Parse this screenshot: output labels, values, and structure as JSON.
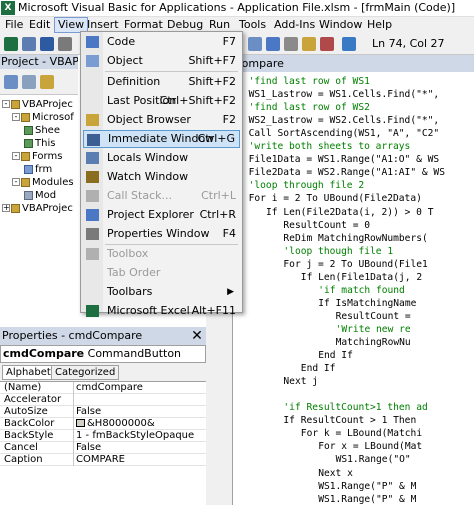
{
  "window": {
    "title": "Microsoft Visual Basic for Applications - Application File.xlsm - [frmMain (Code)]",
    "icon_text": "X"
  },
  "menubar": [
    "File",
    "Edit",
    "View",
    "Insert",
    "Format",
    "Debug",
    "Run",
    "Tools",
    "Add-Ins",
    "Window",
    "Help"
  ],
  "toolbar": {
    "position": "Ln 74, Col 27"
  },
  "project": {
    "title": "Project - VBAProje",
    "tree": [
      "VBAProjec",
      "Microsof",
      "Shee",
      "This",
      "Forms",
      "frm",
      "Modules",
      "Mod",
      "VBAProjec"
    ]
  },
  "properties": {
    "title": "Properties - cmdCompare",
    "object_name": "cmdCompare",
    "object_type": "CommandButton",
    "tabs": [
      "Alphabetic",
      "Categorized"
    ],
    "rows": [
      {
        "name": "(Name)",
        "value": "cmdCompare"
      },
      {
        "name": "Accelerator",
        "value": ""
      },
      {
        "name": "AutoSize",
        "value": "False"
      },
      {
        "name": "BackColor",
        "value": "&H8000000&"
      },
      {
        "name": "BackStyle",
        "value": "1 - fmBackStyleOpaque"
      },
      {
        "name": "Cancel",
        "value": "False"
      },
      {
        "name": "Caption",
        "value": "COMPARE"
      }
    ]
  },
  "code": {
    "title_fragment": "Compare",
    "lines": [
      {
        "text": "'find last row of WS1",
        "indent": 2,
        "kind": "comment"
      },
      {
        "text": "WS1_Lastrow = WS1.Cells.Find(\"*\", ",
        "indent": 2,
        "kind": "code"
      },
      {
        "text": "'find last row of WS2",
        "indent": 2,
        "kind": "comment"
      },
      {
        "text": "WS2_Lastrow = WS2.Cells.Find(\"*\", ",
        "indent": 2,
        "kind": "code"
      },
      {
        "text": "Call SortAscending(WS1, \"A\", \"C2\"",
        "indent": 2,
        "kind": "code"
      },
      {
        "text": "'write both sheets to arrays",
        "indent": 2,
        "kind": "comment"
      },
      {
        "text": "File1Data = WS1.Range(\"A1:O\" & WS",
        "indent": 2,
        "kind": "code"
      },
      {
        "text": "File2Data = WS2.Range(\"A1:AI\" & WS",
        "indent": 2,
        "kind": "code"
      },
      {
        "text": "'loop through file 2",
        "indent": 2,
        "kind": "comment"
      },
      {
        "text": "For i = 2 To UBound(File2Data)",
        "indent": 2,
        "kind": "code"
      },
      {
        "text": "If Len(File2Data(i, 2)) > 0 T",
        "indent": 5,
        "kind": "code"
      },
      {
        "text": "ResultCount = 0",
        "indent": 8,
        "kind": "code"
      },
      {
        "text": "ReDim MatchingRowNumbers(",
        "indent": 8,
        "kind": "code"
      },
      {
        "text": "'loop though file 1",
        "indent": 8,
        "kind": "comment"
      },
      {
        "text": "For j = 2 To UBound(File1",
        "indent": 8,
        "kind": "code"
      },
      {
        "text": "If Len(File1Data(j, 2",
        "indent": 11,
        "kind": "code"
      },
      {
        "text": "'if match found",
        "indent": 14,
        "kind": "comment"
      },
      {
        "text": "If IsMatchingName",
        "indent": 14,
        "kind": "code"
      },
      {
        "text": "ResultCount =",
        "indent": 17,
        "kind": "code"
      },
      {
        "text": "'Write new re",
        "indent": 17,
        "kind": "comment"
      },
      {
        "text": "MatchingRowNu",
        "indent": 17,
        "kind": "code"
      },
      {
        "text": "End If",
        "indent": 14,
        "kind": "code"
      },
      {
        "text": "End If",
        "indent": 11,
        "kind": "code"
      },
      {
        "text": "Next j",
        "indent": 8,
        "kind": "code"
      },
      {
        "text": "",
        "indent": 0,
        "kind": "code"
      },
      {
        "text": "'if ResultCount>1 then ad",
        "indent": 8,
        "kind": "comment"
      },
      {
        "text": "If ResultCount > 1 Then",
        "indent": 8,
        "kind": "code"
      },
      {
        "text": "For k = LBound(Matchi",
        "indent": 11,
        "kind": "code"
      },
      {
        "text": "For x = LBound(Mat",
        "indent": 14,
        "kind": "code"
      },
      {
        "text": "WS1.Range(\"O\"",
        "indent": 17,
        "kind": "code"
      },
      {
        "text": "Next x",
        "indent": 14,
        "kind": "code"
      },
      {
        "text": "WS1.Range(\"P\" & M",
        "indent": 14,
        "kind": "code"
      },
      {
        "text": "WS1.Range(\"P\" & M",
        "indent": 14,
        "kind": "code"
      }
    ]
  },
  "view_menu": {
    "items": [
      {
        "label": "Code",
        "shortcut": "F7",
        "state": "normal",
        "icon": "code-icon"
      },
      {
        "label": "Object",
        "shortcut": "Shift+F7",
        "state": "normal",
        "icon": "object-icon"
      },
      {
        "label": "Definition",
        "shortcut": "Shift+F2",
        "state": "normal",
        "icon": ""
      },
      {
        "label": "Last Position",
        "shortcut": "Ctrl+Shift+F2",
        "state": "normal",
        "icon": ""
      },
      {
        "label": "Object Browser",
        "shortcut": "F2",
        "state": "normal",
        "icon": "object-browser-icon"
      },
      {
        "label": "Immediate Window",
        "shortcut": "Ctrl+G",
        "state": "highlighted",
        "icon": "immediate-window-icon"
      },
      {
        "label": "Locals Window",
        "shortcut": "",
        "state": "normal",
        "icon": "locals-window-icon"
      },
      {
        "label": "Watch Window",
        "shortcut": "",
        "state": "normal",
        "icon": "watch-window-icon"
      },
      {
        "label": "Call Stack...",
        "shortcut": "Ctrl+L",
        "state": "disabled",
        "icon": "call-stack-icon"
      },
      {
        "label": "Project Explorer",
        "shortcut": "Ctrl+R",
        "state": "normal",
        "icon": "project-explorer-icon"
      },
      {
        "label": "Properties Window",
        "shortcut": "F4",
        "state": "normal",
        "icon": "properties-window-icon"
      },
      {
        "label": "Toolbox",
        "shortcut": "",
        "state": "disabled",
        "icon": "toolbox-icon"
      },
      {
        "label": "Tab Order",
        "shortcut": "",
        "state": "disabled",
        "icon": ""
      },
      {
        "label": "Toolbars",
        "shortcut": "",
        "state": "submenu",
        "icon": ""
      },
      {
        "label": "Microsoft Excel",
        "shortcut": "Alt+F11",
        "state": "normal",
        "icon": "excel-icon"
      }
    ]
  }
}
